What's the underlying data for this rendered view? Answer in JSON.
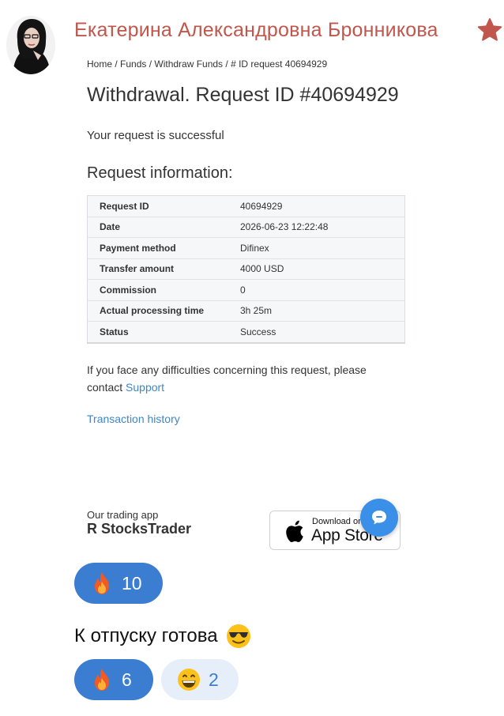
{
  "author": {
    "name": "Екатерина Александровна Бронникова"
  },
  "page": {
    "breadcrumb": "Home / Funds / Withdraw Funds / # ID request 40694929",
    "title": "Withdrawal. Request ID #40694929",
    "success_message": "Your request is successful",
    "info_heading": "Request information:",
    "info_rows": [
      {
        "key": "Request ID",
        "value": "40694929"
      },
      {
        "key": "Date",
        "value": "2026-06-23 12:22:48"
      },
      {
        "key": "Payment method",
        "value": "Difinex"
      },
      {
        "key": "Transfer amount",
        "value": "4000 USD"
      },
      {
        "key": "Commission",
        "value": "0"
      },
      {
        "key": "Actual processing time",
        "value": "3h 25m"
      },
      {
        "key": "Status",
        "value": "Success"
      }
    ],
    "help_text": "If you face any difficulties concerning this request, please contact",
    "support_link": "Support",
    "history_link": "Transaction history",
    "app_caption": "Our trading app",
    "app_name": "R StocksTrader",
    "appstore_small": "Download on the",
    "appstore_big": "App Store"
  },
  "message": {
    "text": "К отпуску готова",
    "text_emoji": "smiling-face-with-sunglasses-icon"
  },
  "reactions": [
    {
      "emoji": "fire-icon",
      "count": "10",
      "active": true
    },
    {
      "emoji": "fire-icon",
      "count": "6",
      "active": true
    },
    {
      "emoji": "grinning-face-icon",
      "count": "2",
      "active": false
    }
  ],
  "colors": {
    "author": "#c0564c",
    "link": "#3f86c4",
    "reaction_active": "#3b7dd0",
    "reaction_inactive": "#e6eff9",
    "chat_button": "#3a8fe8"
  }
}
